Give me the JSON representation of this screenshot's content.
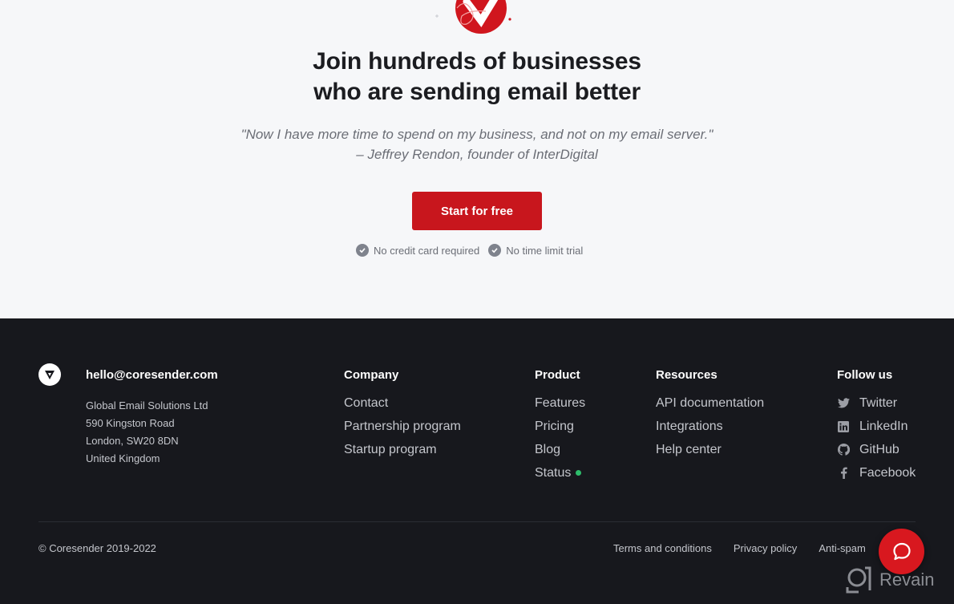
{
  "cta": {
    "title_line1": "Join hundreds of businesses",
    "title_line2": "who are sending email better",
    "quote": "\"Now I have more time to spend on my business, and not on my email server.\"",
    "attribution": "– Jeffrey Rendon, founder of InterDigital",
    "start_button": "Start for free",
    "perks": [
      "No credit card required",
      "No time limit trial"
    ]
  },
  "footer": {
    "email": "hello@coresender.com",
    "address": [
      "Global Email Solutions Ltd",
      "590 Kingston Road",
      "London, SW20 8DN",
      "United Kingdom"
    ],
    "company": {
      "title": "Company",
      "links": [
        "Contact",
        "Partnership program",
        "Startup program"
      ]
    },
    "product": {
      "title": "Product",
      "links": [
        "Features",
        "Pricing",
        "Blog",
        "Status"
      ],
      "status_color": "#2ebd6b"
    },
    "resources": {
      "title": "Resources",
      "links": [
        "API documentation",
        "Integrations",
        "Help center"
      ]
    },
    "follow": {
      "title": "Follow us",
      "links": [
        {
          "label": "Twitter",
          "icon": "twitter-icon"
        },
        {
          "label": "LinkedIn",
          "icon": "linkedin-icon"
        },
        {
          "label": "GitHub",
          "icon": "github-icon"
        },
        {
          "label": "Facebook",
          "icon": "facebook-icon"
        }
      ]
    },
    "copyright": "© Coresender 2019-2022",
    "legal": [
      "Terms and conditions",
      "Privacy policy",
      "Anti-spam"
    ]
  },
  "widgets": {
    "chat_icon": "chat-bubble-icon",
    "watermark": "Revain"
  },
  "colors": {
    "brand_red": "#c8161d",
    "footer_bg": "#17181d",
    "page_bg": "#f6f7f9"
  }
}
